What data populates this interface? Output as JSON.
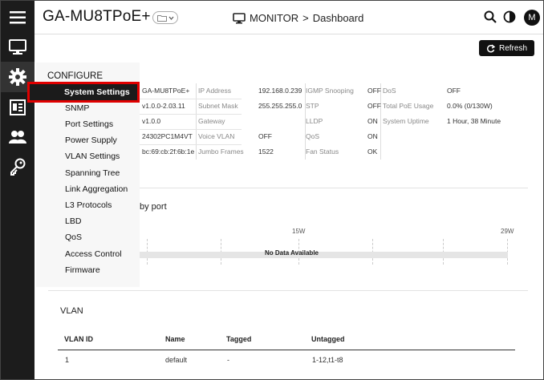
{
  "header": {
    "title": "GA-MU8TPoE+",
    "crumb_section": "MONITOR",
    "crumb_sep": ">",
    "crumb_page": "Dashboard",
    "avatar_initial": "M"
  },
  "toolbar": {
    "refresh_label": "Refresh"
  },
  "sidebar": {
    "icons": [
      "menu-icon",
      "monitor-icon",
      "gear-icon",
      "dashboard-list-icon",
      "users-icon",
      "key-icon"
    ]
  },
  "menu": {
    "heading": "CONFIGURE",
    "items": [
      "System Settings",
      "SNMP",
      "Port Settings",
      "Power Supply",
      "VLAN Settings",
      "Spanning Tree",
      "Link Aggregation",
      "L3 Protocols",
      "LBD",
      "QoS",
      "Access Control",
      "Firmware"
    ],
    "selected": "System Settings"
  },
  "info": {
    "col1": [
      "GA-MU8TPoE+",
      "v1.0.0-2.03.11",
      "v1.0.0",
      "24302PC1M4VT",
      "bc:69:cb:2f:6b:1e"
    ],
    "col2_labels": [
      "IP Address",
      "Subnet Mask",
      "Gateway",
      "Voice VLAN",
      "Jumbo Frames"
    ],
    "col2_values": [
      "192.168.0.239",
      "255.255.255.0",
      "",
      "OFF",
      "1522"
    ],
    "col3_labels": [
      "IGMP Snooping",
      "STP",
      "LLDP",
      "QoS",
      "Fan Status"
    ],
    "col3_values": [
      "OFF",
      "OFF",
      "ON",
      "ON",
      "OK"
    ],
    "col4_labels": [
      "DoS",
      "Total PoE Usage",
      "System Uptime"
    ],
    "col4_values": [
      "OFF",
      "0.0% (0/130W)",
      "1 Hour, 38 Minute"
    ]
  },
  "port": {
    "title_fragment": "by port",
    "axis_mid": "15W",
    "axis_end": "29W",
    "no_data": "No Data Available"
  },
  "vlan": {
    "title": "VLAN",
    "columns": [
      "VLAN ID",
      "Name",
      "Tagged",
      "Untagged"
    ],
    "rows": [
      [
        "1",
        "default",
        "-",
        "1-12,t1-t8"
      ]
    ]
  }
}
